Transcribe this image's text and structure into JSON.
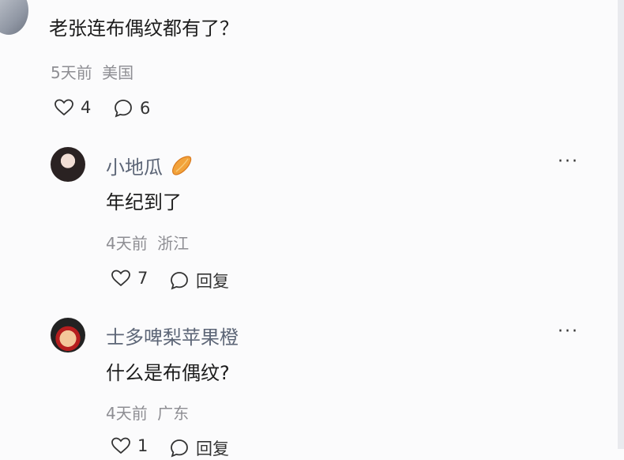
{
  "main_comment": {
    "text": "老张连布偶纹都有了？",
    "time": "5天前",
    "location": "美国",
    "likes": "4",
    "replies": "6"
  },
  "replies": [
    {
      "username": "小地瓜",
      "badge_icon": "sweet-potato-icon",
      "text": "年纪到了",
      "time": "4天前",
      "location": "浙江",
      "likes": "7",
      "reply_label": "回复"
    },
    {
      "username": "士多啤梨苹果橙",
      "text": "什么是布偶纹?",
      "time": "4天前",
      "location": "广东",
      "likes": "1",
      "reply_label": "回复"
    }
  ],
  "more_label": "···"
}
